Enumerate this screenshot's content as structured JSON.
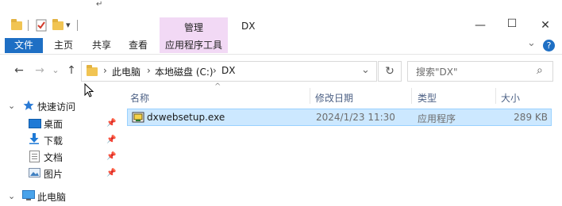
{
  "window": {
    "title": "DX",
    "manage_tab": "管理",
    "qat_dropdown": "▾",
    "minimize_symbol": "—",
    "maximize_symbol": "☐",
    "close_symbol": "✕",
    "cursor_mark": "↵"
  },
  "ribbon": {
    "file_tab": "文件",
    "tabs": [
      "主页",
      "共享",
      "查看"
    ],
    "app_tools_tab": "应用程序工具",
    "expand_symbol": "⌄",
    "help_symbol": "?"
  },
  "address_bar": {
    "back_symbol": "←",
    "forward_symbol": "→",
    "recent_symbol": "⌄",
    "up_symbol": "↑",
    "breadcrumb": [
      "此电脑",
      "本地磁盘 (C:)",
      "DX"
    ],
    "separator": "›",
    "dropdown_symbol": "⌄",
    "refresh_symbol": "↻",
    "search_placeholder": "搜索\"DX\"",
    "search_icon_symbol": "⌕"
  },
  "nav_pane": {
    "quick_access": "快速访问",
    "items": [
      {
        "label": "桌面",
        "icon": "desktop-icon",
        "pinned": true
      },
      {
        "label": "下载",
        "icon": "download-icon",
        "pinned": true
      },
      {
        "label": "文档",
        "icon": "documents-icon",
        "pinned": true
      },
      {
        "label": "图片",
        "icon": "pictures-icon",
        "pinned": true
      }
    ],
    "this_pc": "此电脑",
    "pin_symbol": "📌",
    "expand_symbol": "›",
    "collapse_symbol": "⌄"
  },
  "file_list": {
    "sort_indicator": "^",
    "columns": [
      "名称",
      "修改日期",
      "类型",
      "大小"
    ],
    "rows": [
      {
        "name": "dxwebsetup.exe",
        "modified": "2024/1/23 11:30",
        "type": "应用程序",
        "size": "289 KB",
        "selected": true
      }
    ]
  },
  "colors": {
    "file_tab": "#1e6fc4",
    "contextual_tab": "#f2d9f5",
    "selection": "#cce8ff",
    "folder": "#f1c453",
    "header_text": "#4d6185"
  }
}
